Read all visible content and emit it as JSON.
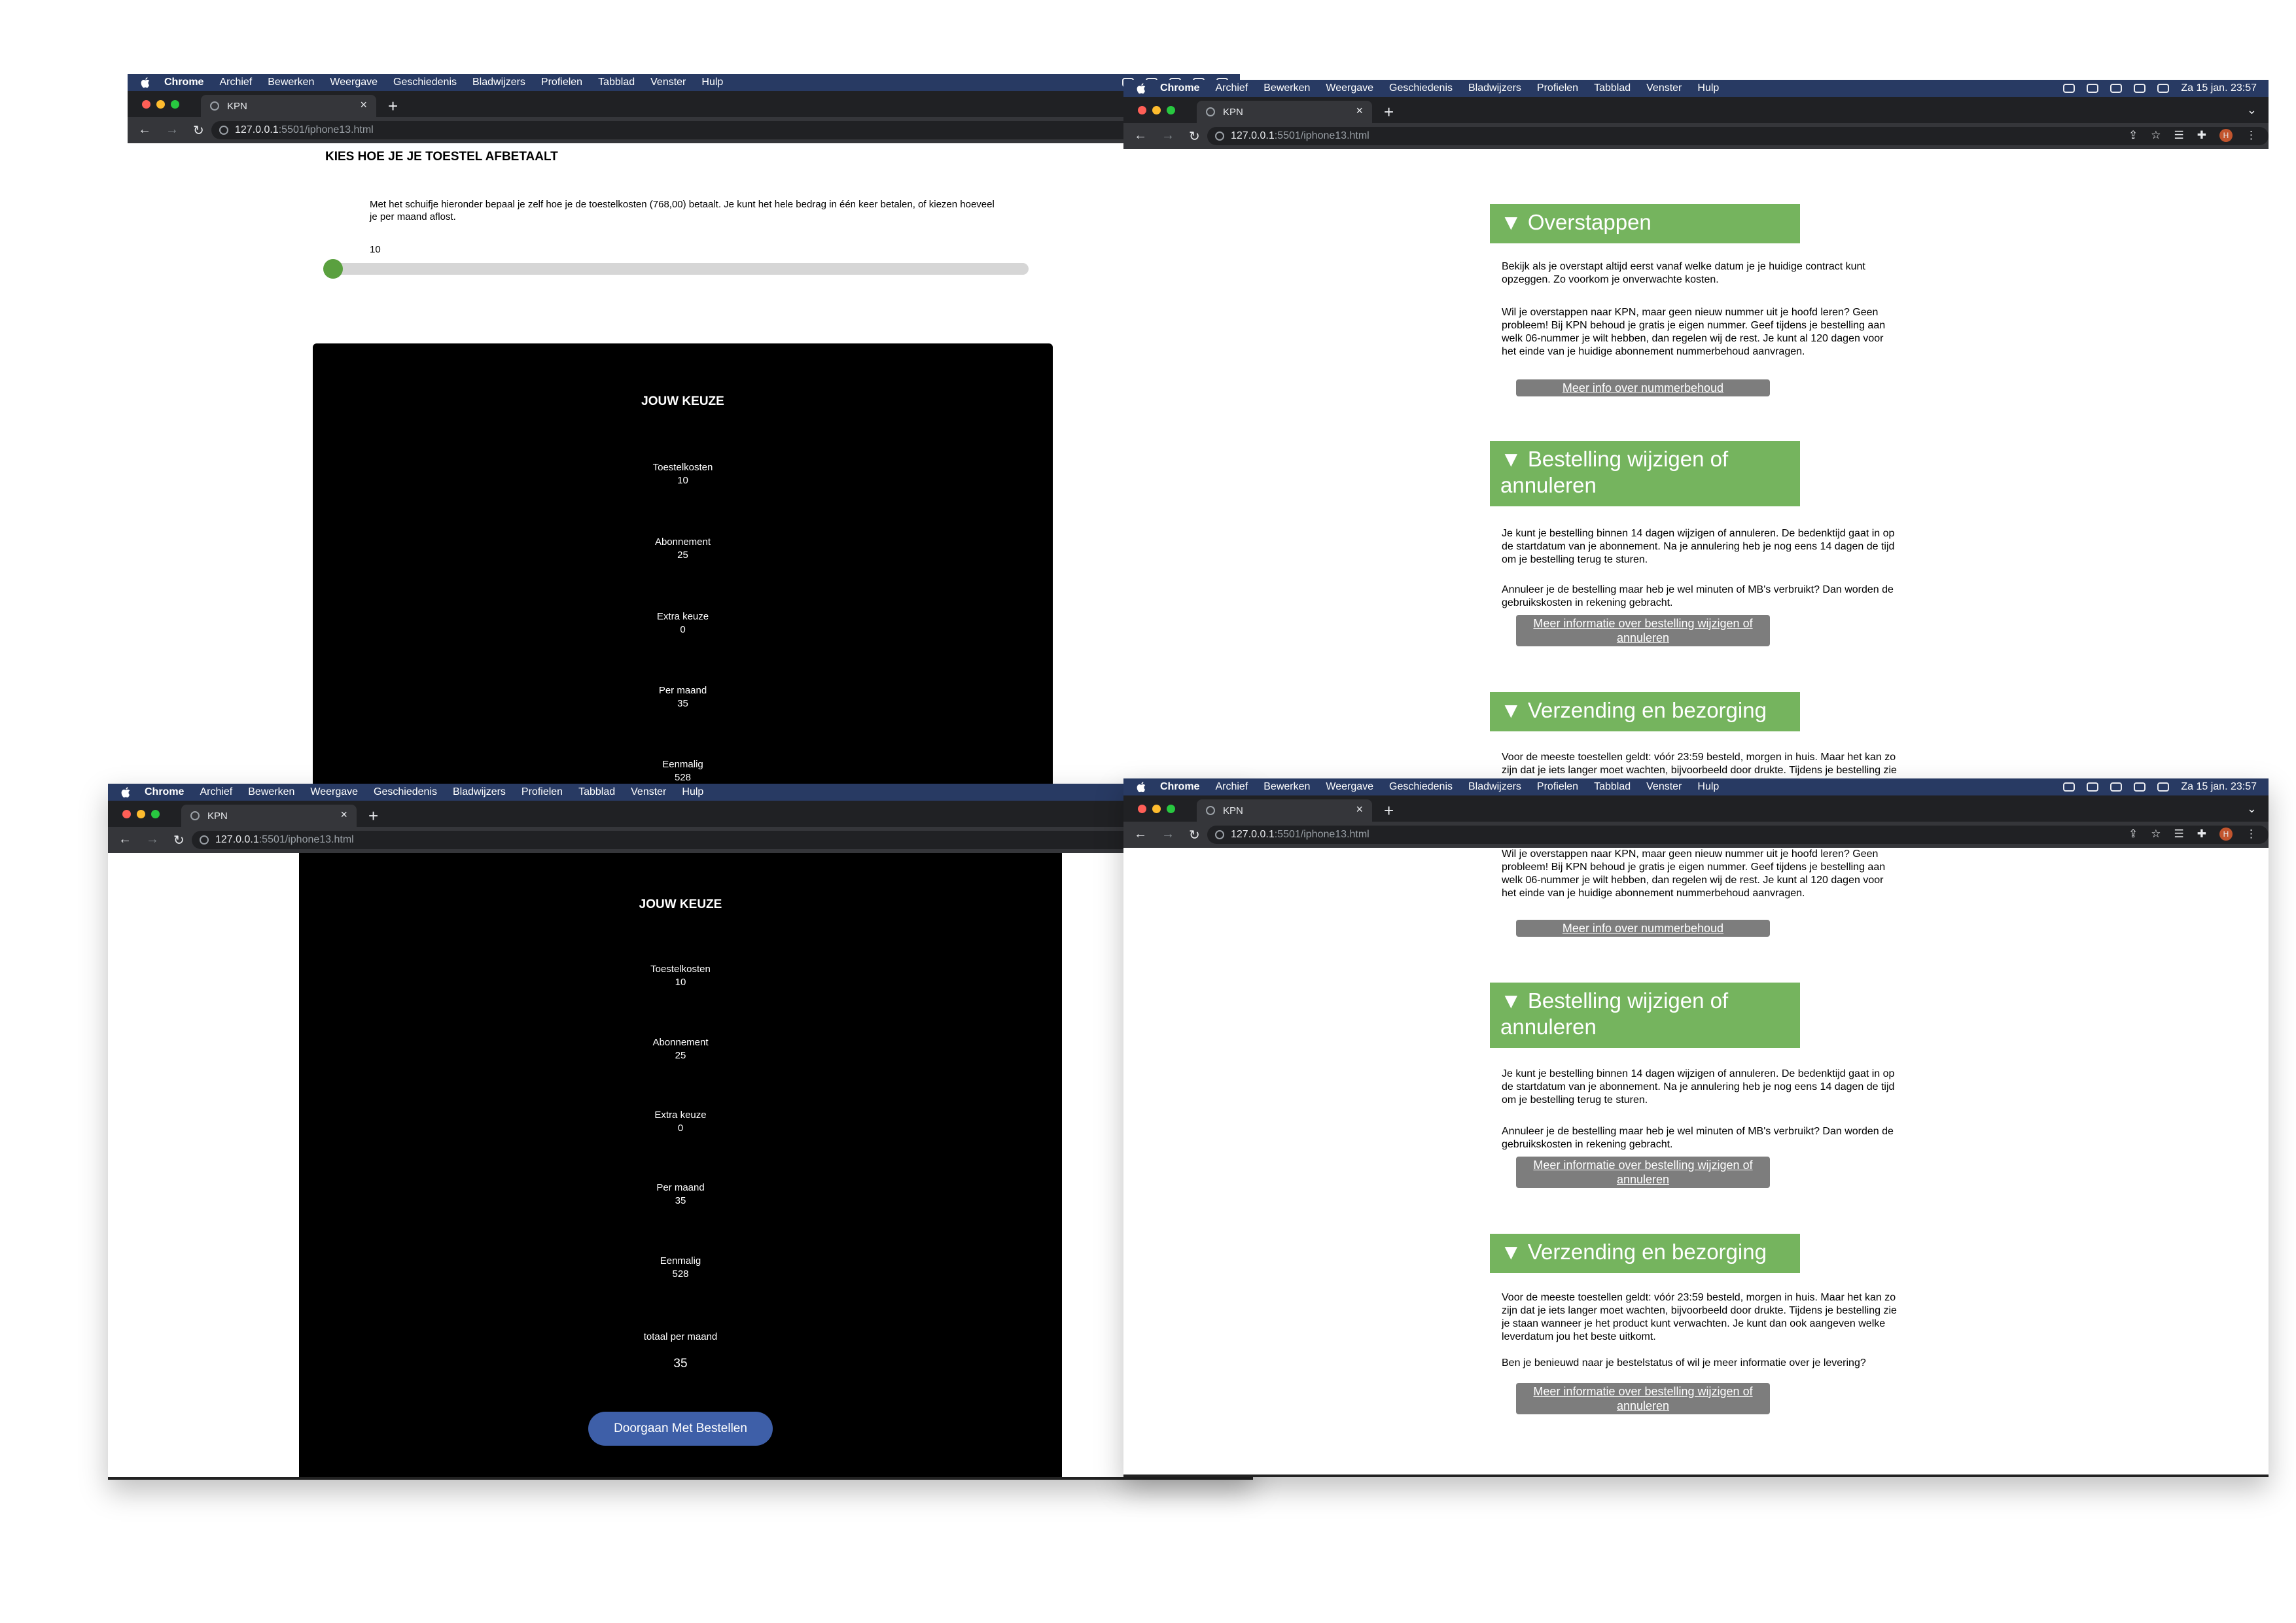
{
  "menubar": {
    "app": "Chrome",
    "items": [
      "Archief",
      "Bewerken",
      "Weergave",
      "Geschiedenis",
      "Bladwijzers",
      "Profielen",
      "Tabblad",
      "Venster",
      "Hulp"
    ],
    "clock": "Za 15 jan. 23:57"
  },
  "browser": {
    "tab_title": "KPN",
    "url_host": "127.0.0.1",
    "url_path": ":5501/iphone13.html",
    "profile_initial": "H"
  },
  "payment": {
    "title": "KIES HOE JE JE TOESTEL AFBETAALT",
    "description": "Met het schuifje hieronder bepaal je zelf hoe je de toestelkosten (768,00) betaalt. Je kunt het hele bedrag in één keer betalen, of kiezen hoeveel je per maand aflost.",
    "slider_value": "10",
    "slider_fraction": 0.0
  },
  "keuze": {
    "title": "JOUW KEUZE",
    "rows": [
      {
        "label": "Toestelkosten",
        "value": "10"
      },
      {
        "label": "Abonnement",
        "value": "25"
      },
      {
        "label": "Extra keuze",
        "value": "0"
      },
      {
        "label": "Per maand",
        "value": "35"
      },
      {
        "label": "Eenmalig",
        "value": "528"
      }
    ],
    "total_label": "totaal per maand",
    "total_value": "35",
    "button": "Doorgaan Met Bestellen"
  },
  "info": {
    "overstappen": {
      "title": "▼ Overstappen",
      "p1": "Bekijk als je overstapt altijd eerst vanaf welke datum je je huidige contract kunt opzeggen. Zo voorkom je onverwachte kosten.",
      "p2": "Wil je overstappen naar KPN, maar geen nieuw nummer uit je hoofd leren? Geen probleem! Bij KPN behoud je gratis je eigen nummer. Geef tijdens je bestelling aan welk 06-nummer je wilt hebben, dan regelen wij de rest. Je kunt al 120 dagen voor het einde van je huidige abonnement nummerbehoud aanvragen.",
      "button": "Meer info over nummerbehoud"
    },
    "bestelling": {
      "title": "▼ Bestelling wijzigen of annuleren",
      "p1": "Je kunt je bestelling binnen 14 dagen wijzigen of annuleren. De bedenktijd gaat in op de startdatum van je abonnement. Na je annulering heb je nog eens 14 dagen de tijd om je bestelling terug te sturen.",
      "p2": "Annuleer je de bestelling maar heb je wel minuten of MB's verbruikt? Dan worden de gebruikskosten in rekening gebracht.",
      "button": "Meer informatie over bestelling wijzigen of annuleren"
    },
    "verzending": {
      "title": "▼ Verzending en bezorging",
      "p1": "Voor de meeste toestellen geldt: vóór 23:59 besteld, morgen in huis. Maar het kan zo zijn dat je iets langer moet wachten, bijvoorbeeld door drukte. Tijdens je bestelling zie je staan wanneer je het product kunt verwachten. Je kunt dan ook aangeven welke leverdatum jou het beste uitkomt.",
      "p2": "Ben je benieuwd naar je bestelstatus of wil je meer informatie over je levering?",
      "button": "Meer informatie over bestelling wijzigen of annuleren"
    }
  }
}
